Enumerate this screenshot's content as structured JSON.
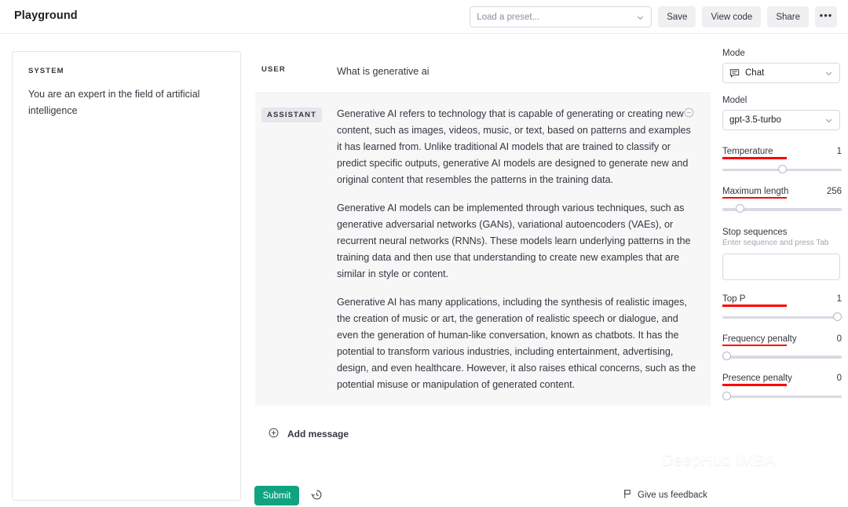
{
  "header": {
    "title": "Playground",
    "preset_placeholder": "Load a preset...",
    "save_label": "Save",
    "view_code_label": "View code",
    "share_label": "Share",
    "more_label": "•••"
  },
  "system": {
    "label": "SYSTEM",
    "text": "You are an expert in the field of artificial intelligence"
  },
  "conversation": {
    "user": {
      "role": "USER",
      "text": "What is generative ai"
    },
    "assistant": {
      "role": "ASSISTANT",
      "paragraphs": [
        "Generative AI refers to technology that is capable of generating or creating new content, such as images, videos, music, or text, based on patterns and examples it has learned from. Unlike traditional AI models that are trained to classify or predict specific outputs, generative AI models are designed to generate new and original content that resembles the patterns in the training data.",
        "Generative AI models can be implemented through various techniques, such as generative adversarial networks (GANs), variational autoencoders (VAEs), or recurrent neural networks (RNNs). These models learn underlying patterns in the training data and then use that understanding to create new examples that are similar in style or content.",
        "Generative AI has many applications, including the synthesis of realistic images, the creation of music or art, the generation of realistic speech or dialogue, and even the generation of human-like conversation, known as chatbots. It has the potential to transform various industries, including entertainment, advertising, design, and even healthcare. However, it also raises ethical concerns, such as the potential misuse or manipulation of generated content."
      ]
    },
    "add_message_label": "Add message"
  },
  "footer": {
    "submit_label": "Submit",
    "feedback_label": "Give us feedback"
  },
  "settings": {
    "mode": {
      "label": "Mode",
      "value": "Chat"
    },
    "model": {
      "label": "Model",
      "value": "gpt-3.5-turbo"
    },
    "temperature": {
      "label": "Temperature",
      "value": "1",
      "fill": 50
    },
    "maximum_length": {
      "label": "Maximum length",
      "value": "256",
      "fill": 12
    },
    "stop_sequences": {
      "label": "Stop sequences",
      "hint": "Enter sequence and press Tab",
      "value": ""
    },
    "top_p": {
      "label": "Top P",
      "value": "1",
      "fill": 100
    },
    "frequency_penalty": {
      "label": "Frequency penalty",
      "value": "0",
      "fill": 0
    },
    "presence_penalty": {
      "label": "Presence penalty",
      "value": "0",
      "fill": 0
    }
  },
  "watermark": {
    "text": "DeepHub IMBA"
  },
  "colors": {
    "accent_green": "#10a37f",
    "annotation_red": "#ff0000",
    "assistant_bg": "#f7f7f8"
  }
}
